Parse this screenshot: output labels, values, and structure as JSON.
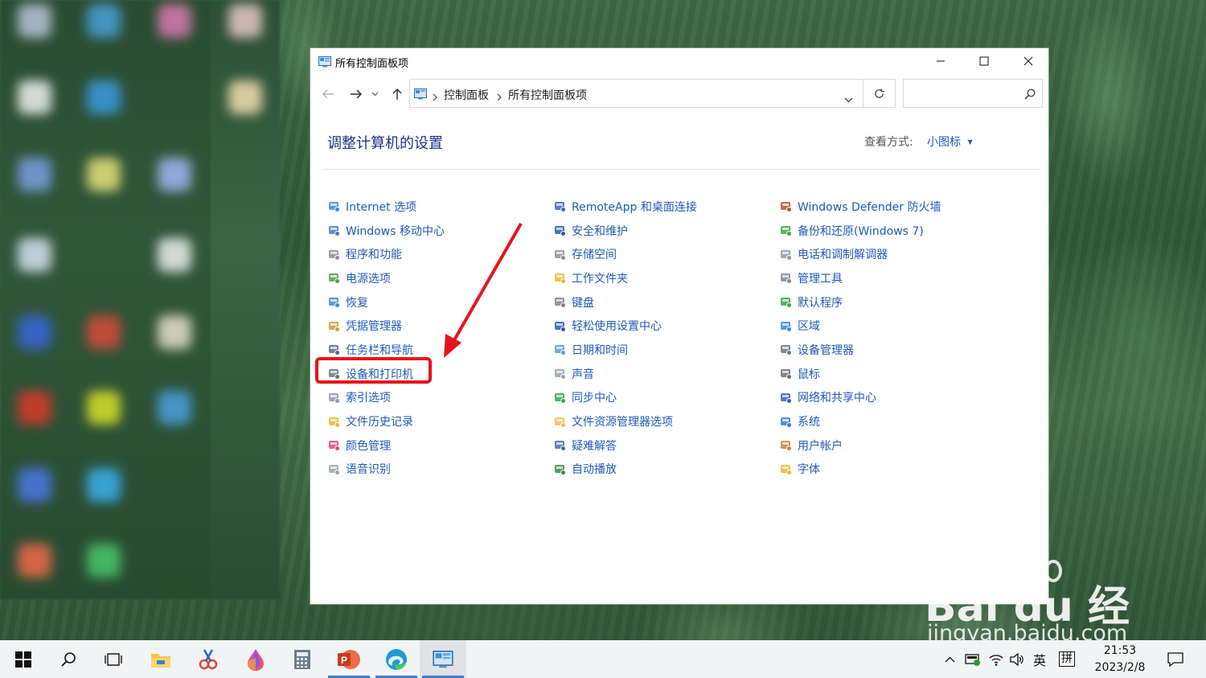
{
  "window": {
    "title": "所有控制面板项",
    "breadcrumb": [
      "控制面板",
      "所有控制面板项"
    ],
    "search_placeholder": "",
    "heading": "调整计算机的设置",
    "view_by_label": "查看方式:",
    "view_by_value": "小图标"
  },
  "columns": [
    [
      {
        "label": "Internet 选项",
        "icon": "globe-icon"
      },
      {
        "label": "Windows 移动中心",
        "icon": "mobility-center-icon"
      },
      {
        "label": "程序和功能",
        "icon": "programs-icon"
      },
      {
        "label": "电源选项",
        "icon": "power-icon"
      },
      {
        "label": "恢复",
        "icon": "recovery-icon"
      },
      {
        "label": "凭据管理器",
        "icon": "credential-icon"
      },
      {
        "label": "任务栏和导航",
        "icon": "taskbar-icon"
      },
      {
        "label": "设备和打印机",
        "icon": "printer-icon"
      },
      {
        "label": "索引选项",
        "icon": "index-icon"
      },
      {
        "label": "文件历史记录",
        "icon": "file-history-icon"
      },
      {
        "label": "颜色管理",
        "icon": "color-management-icon"
      },
      {
        "label": "语音识别",
        "icon": "microphone-icon"
      }
    ],
    [
      {
        "label": "RemoteApp 和桌面连接",
        "icon": "remoteapp-icon"
      },
      {
        "label": "安全和维护",
        "icon": "flag-icon"
      },
      {
        "label": "存储空间",
        "icon": "storage-icon"
      },
      {
        "label": "工作文件夹",
        "icon": "work-folder-icon"
      },
      {
        "label": "键盘",
        "icon": "keyboard-icon"
      },
      {
        "label": "轻松使用设置中心",
        "icon": "ease-of-access-icon"
      },
      {
        "label": "日期和时间",
        "icon": "clock-icon"
      },
      {
        "label": "声音",
        "icon": "speaker-icon"
      },
      {
        "label": "同步中心",
        "icon": "sync-icon"
      },
      {
        "label": "文件资源管理器选项",
        "icon": "folder-options-icon"
      },
      {
        "label": "疑难解答",
        "icon": "troubleshoot-icon"
      },
      {
        "label": "自动播放",
        "icon": "autoplay-icon"
      }
    ],
    [
      {
        "label": "Windows Defender 防火墙",
        "icon": "firewall-icon"
      },
      {
        "label": "备份和还原(Windows 7)",
        "icon": "backup-icon"
      },
      {
        "label": "电话和调制解调器",
        "icon": "phone-icon"
      },
      {
        "label": "管理工具",
        "icon": "admin-tools-icon"
      },
      {
        "label": "默认程序",
        "icon": "default-programs-icon"
      },
      {
        "label": "区域",
        "icon": "region-icon"
      },
      {
        "label": "设备管理器",
        "icon": "device-manager-icon"
      },
      {
        "label": "鼠标",
        "icon": "mouse-icon"
      },
      {
        "label": "网络和共享中心",
        "icon": "network-icon"
      },
      {
        "label": "系统",
        "icon": "system-icon"
      },
      {
        "label": "用户帐户",
        "icon": "user-accounts-icon"
      },
      {
        "label": "字体",
        "icon": "fonts-icon"
      }
    ]
  ],
  "watermark": {
    "brand": "Bai du 经验",
    "url": "jingyan.baidu.com"
  },
  "taskbar": {
    "apps": [
      "start-icon",
      "search-icon",
      "task-view-icon",
      "file-explorer-icon",
      "snipping-tool-icon",
      "paint-drop-icon",
      "calculator-icon",
      "powerpoint-icon",
      "edge-icon",
      "control-panel-icon"
    ],
    "ime_language": "英",
    "ime_mode": "拼",
    "time": "21:53",
    "date": "2023/2/8"
  },
  "colors": {
    "link": "#1e5bb8",
    "heading": "#1e3287",
    "highlight": "#e8141b",
    "taskbar": "#f2f3f4"
  }
}
